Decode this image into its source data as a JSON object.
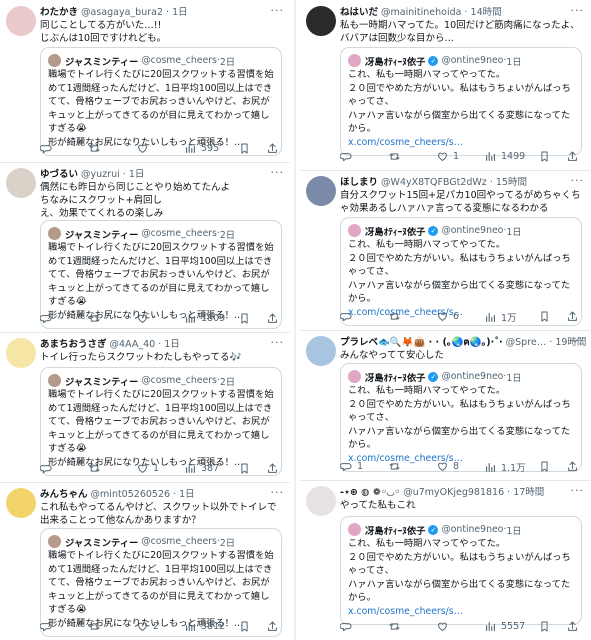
{
  "left": [
    {
      "avatar_color": "#e9c9c9",
      "name": "わたかき",
      "handle": "@asagaya_bura2",
      "time": "1日",
      "body": "同じことしてる方がいた…!!\nじぶんは10回ですけれども。",
      "quote": {
        "name": "ジャスミンティー",
        "handle": "@cosme_cheers",
        "time": "2日",
        "avatar_color": "#b39a8a",
        "verified": false,
        "text": "職場でトイレ行くたびに20回スクワットする習慣を始めて1週間経ったんだけど、1日平均100回以上はできてて、骨格ウェーブでお尻おっきいんやけど、お尻がキュッと上がってきてるのが目に見えてわかって嬉しすぎる😭\n形が綺麗なお尻になりたいしもっと頑張る！…"
      },
      "stats": {
        "replies": "",
        "retweets": "",
        "likes": "",
        "views": "595"
      }
    },
    {
      "avatar_color": "#d8d2c8",
      "name": "ゆづるい",
      "handle": "@yuzrui",
      "time": "1日",
      "body": "偶然にも昨日から同じことやり始めてたんよ\nちなみにスクワット+肩回し\nえ、効果でてくれるの楽しみ",
      "quote": {
        "name": "ジャスミンティー",
        "handle": "@cosme_cheers",
        "time": "2日",
        "avatar_color": "#b39a8a",
        "verified": false,
        "text": "職場でトイレ行くたびに20回スクワットする習慣を始めて1週間経ったんだけど、1日平均100回以上はできてて、骨格ウェーブでお尻おっきいんやけど、お尻がキュッと上がってきてるのが目に見えてわかって嬉しすぎる😭\n形が綺麗なお尻になりたいしもっと頑張る！…"
      },
      "stats": {
        "replies": "",
        "retweets": "",
        "likes": "",
        "views": "1809"
      }
    },
    {
      "avatar_color": "#f6e6a6",
      "name": "あまちおうさぎ",
      "handle": "@4AA_40",
      "time": "1日",
      "body": "トイレ行ったらスクワットわたしもやってる🎶",
      "quote": {
        "name": "ジャスミンティー",
        "handle": "@cosme_cheers",
        "time": "2日",
        "avatar_color": "#b39a8a",
        "verified": false,
        "text": "職場でトイレ行くたびに20回スクワットする習慣を始めて1週間経ったんだけど、1日平均100回以上はできてて、骨格ウェーブでお尻おっきいんやけど、お尻がキュッと上がってきてるのが目に見えてわかって嬉しすぎる😭\n形が綺麗なお尻になりたいしもっと頑張る！…"
      },
      "stats": {
        "replies": "",
        "retweets": "",
        "likes": "1",
        "views": "387"
      }
    },
    {
      "avatar_color": "#f3d46a",
      "name": "みんちゃん",
      "handle": "@mint05260526",
      "time": "1日",
      "body": "これ私もやってるんやけど、スクワット以外でトイレで出来ることって他なんかありますか？",
      "quote": {
        "name": "ジャスミンティー",
        "handle": "@cosme_cheers",
        "time": "2日",
        "avatar_color": "#b39a8a",
        "verified": false,
        "text": "職場でトイレ行くたびに20回スクワットする習慣を始めて1週間経ったんだけど、1日平均100回以上はできてて、骨格ウェーブでお尻おっきいんやけど、お尻がキュッと上がってきてるのが目に見えてわかって嬉しすぎる😭\n形が綺麗なお尻になりたいしもっと頑張る！…"
      },
      "stats": {
        "replies": "",
        "retweets": "",
        "likes": "2",
        "views": "3812"
      }
    }
  ],
  "right": [
    {
      "avatar_color": "#2a2a2a",
      "name": "ねはいだ",
      "handle": "@mainitinehoida",
      "time": "14時間",
      "body": "私も一時期ハマってた。10回だけど筋肉痛になったよ、ババアは回数少な目から…",
      "quote": {
        "name": "冴島ｵﾃｨｰﾇ依子",
        "handle": "@ontine9neo",
        "time": "1日",
        "avatar_color": "#e0a7c4",
        "verified": true,
        "text": "これ、私も一時期ハマってやってた。\n２０回でやめた方がいい。私はもうちょいがんばっちゃってさ、\nハァハァ言いながら個室から出てくる変態になってたから。",
        "link": "x.com/cosme_cheers/s…"
      },
      "stats": {
        "replies": "",
        "retweets": "",
        "likes": "1",
        "views": "1499"
      }
    },
    {
      "avatar_color": "#7a8aa8",
      "name": "ほしまり",
      "handle": "@W4yX8TQFBGt2dWz",
      "time": "15時間",
      "body": "自分スクワット15回+足パカ10回やってるがめちゃくちゃ効果あるしハァハァ言ってる変態になるわかる",
      "quote": {
        "name": "冴島ｵﾃｨｰﾇ依子",
        "handle": "@ontine9neo",
        "time": "1日",
        "avatar_color": "#e0a7c4",
        "verified": true,
        "text": "これ、私も一時期ハマってやってた。\n２０回でやめた方がいい。私はもうちょいがんばっちゃってさ、\nハァハァ言いながら個室から出てくる変態になってたから。",
        "link": "x.com/cosme_cheers/s…"
      },
      "stats": {
        "replies": "",
        "retweets": "",
        "likes": "6",
        "views": "1万"
      }
    },
    {
      "avatar_color": "#a8c4e0",
      "name": "プラレベ🐟🔍🦊👜 · · (｡🌏ฅ🌏｡)·˚·",
      "handle": "@Spre…",
      "time": "19時間",
      "body": "みんなやってて安心した",
      "quote": {
        "name": "冴島ｵﾃｨｰﾇ依子",
        "handle": "@ontine9neo",
        "time": "1日",
        "avatar_color": "#e0a7c4",
        "verified": true,
        "text": "これ、私も一時期ハマってやってた。\n２０回でやめた方がいい。私はもうちょいがんばっちゃってさ、\nハァハァ言いながら個室から出てくる変態になってたから。",
        "link": "x.com/cosme_cheers/s…"
      },
      "stats": {
        "replies": "1",
        "retweets": "",
        "likes": "8",
        "views": "1.1万"
      }
    },
    {
      "avatar_color": "#e8e2e2",
      "name": "-⋆⊛ ◍ ❁◦◡◦",
      "handle": "@u7myOKjeg981816",
      "time": "17時間",
      "body": "やってた私もこれ",
      "quote": {
        "name": "冴島ｵﾃｨｰﾇ依子",
        "handle": "@ontine9neo",
        "time": "1日",
        "avatar_color": "#e0a7c4",
        "verified": true,
        "text": "これ、私も一時期ハマってやってた。\n２０回でやめた方がいい。私はもうちょいがんばっちゃってさ、\nハァハァ言いながら個室から出てくる変態になってたから。",
        "link": "x.com/cosme_cheers/s…"
      },
      "stats": {
        "replies": "",
        "retweets": "",
        "likes": "",
        "views": "5557"
      }
    }
  ]
}
